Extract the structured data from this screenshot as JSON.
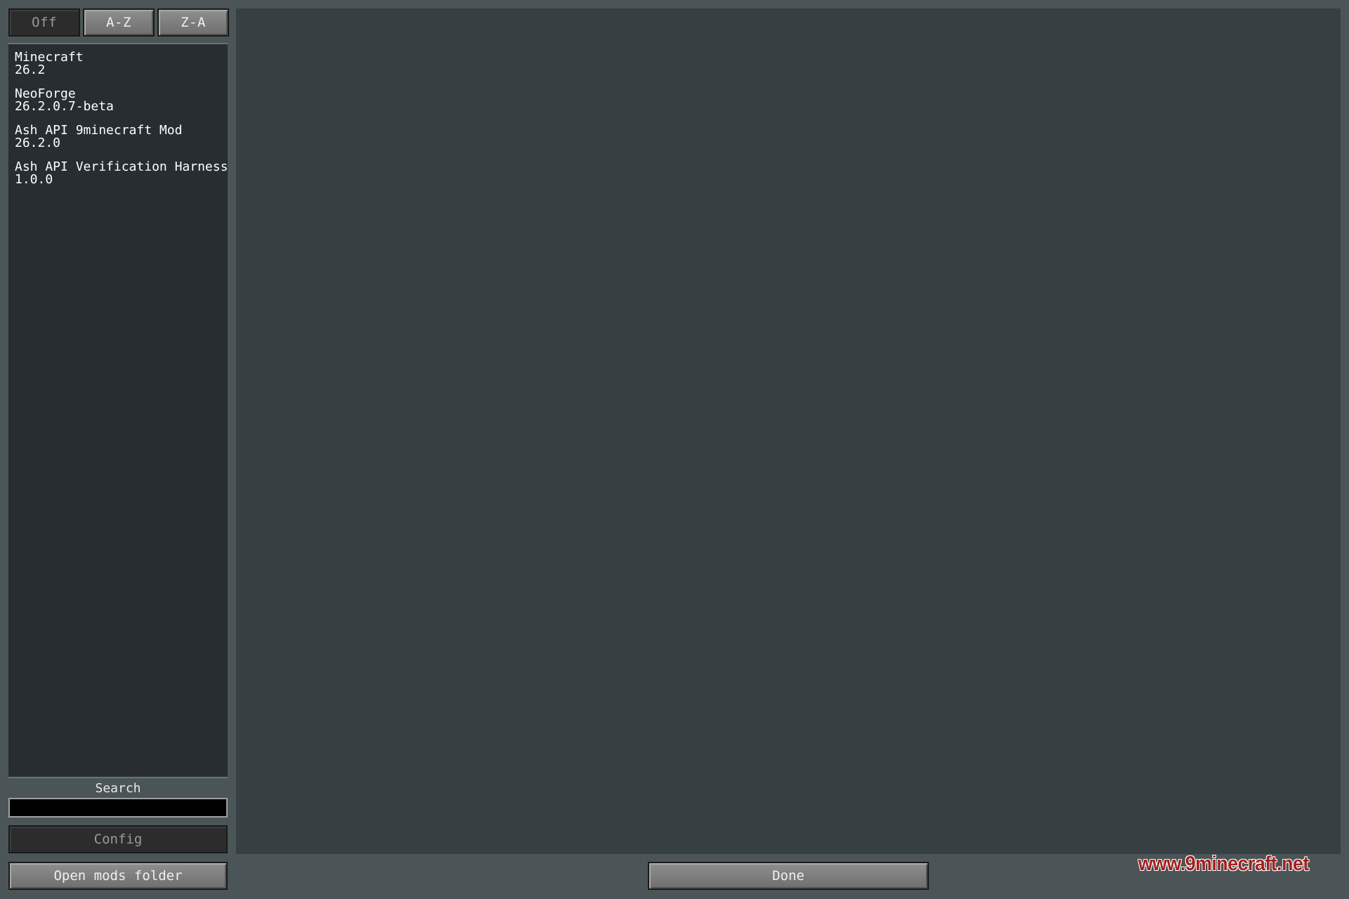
{
  "sort_buttons": {
    "off": "Off",
    "az": "A-Z",
    "za": "Z-A"
  },
  "mods": [
    {
      "name": "Minecraft",
      "version": "26.2"
    },
    {
      "name": "NeoForge",
      "version": "26.2.0.7-beta"
    },
    {
      "name": "Ash API 9minecraft Mod",
      "version": "26.2.0"
    },
    {
      "name": "Ash API Verification Harness",
      "version": "1.0.0"
    }
  ],
  "search": {
    "label": "Search",
    "value": ""
  },
  "buttons": {
    "config": "Config",
    "open_mods_folder": "Open mods folder",
    "done": "Done"
  },
  "watermark": "www.9minecraft.net",
  "colors": {
    "background": "#4b5557",
    "list_bg": "#272d30",
    "details_bg": "#363f42",
    "watermark": "#a32020"
  }
}
